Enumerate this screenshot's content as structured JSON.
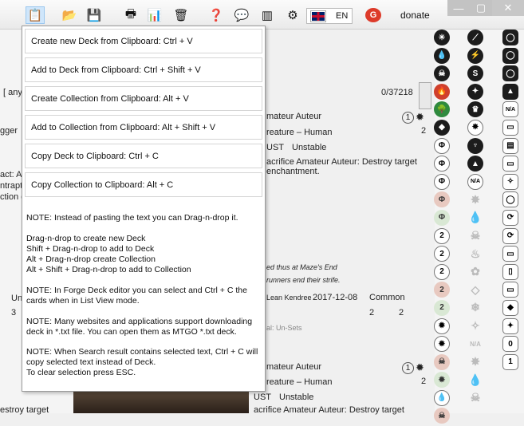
{
  "toolbar": {
    "icons": [
      "paste-icon",
      "open-folder-icon",
      "save-icon",
      "print-icon",
      "chart-icon",
      "trash-icon",
      "help-icon",
      "comment-icon",
      "layout-icon",
      "gear-icon"
    ],
    "language": "EN",
    "donate": "donate"
  },
  "menu": {
    "items": [
      "Create new Deck from Clipboard: Ctrl + V",
      "Add to Deck from Clipboard: Ctrl + Shift + V",
      "Create Collection from Clipboard: Alt + V",
      "Add to Collection from Clipboard: Alt + Shift + V",
      "Copy Deck to Clipboard: Ctrl + C",
      "Copy Collection to Clipboard: Alt + C"
    ],
    "notes": [
      "NOTE: Instead of pasting the text you can Drag-n-drop it.",
      "Drag-n-drop to create new Deck\nShift + Drag-n-drop to add to Deck\nAlt + Drag-n-drop create Collection\nAlt + Shift + Drag-n-drop to add to Collection",
      "NOTE: In Forge Deck editor you can select and Ctrl + C the cards when in List View mode.",
      "NOTE: Many websites and applications support downloading deck in *.txt file. You can open them as MTGO *.txt deck.",
      "NOTE: When Search result contains selected text, Ctrl + C will copy selected text instead of Deck.\nTo clear selection press ESC."
    ]
  },
  "background": {
    "search_stub": "[ any",
    "counter": "0/37218",
    "left_fragments": [
      "gger",
      "act: A",
      "ntrapt",
      "ction de",
      "Un",
      "3",
      "estroy target"
    ],
    "card1": {
      "name": "mateur Auteur",
      "type": "reature – Human",
      "set_code": "UST",
      "set_name": "Unstable",
      "text": "acrifice Amateur Auteur: Destroy target\nenchantment.",
      "count": "2",
      "mana": "1"
    },
    "flavor": "ed thus at Maze's End\nrunners end their strife.",
    "artist": "Lean Kendree",
    "date": "2017-12-08",
    "rarity": "Common",
    "num_a": "2",
    "num_b": "2",
    "legal": "al: Un-Sets",
    "card2": {
      "name": "mateur Auteur",
      "type": "reature – Human",
      "set_code": "UST",
      "set_name": "Unstable",
      "text": "acrifice Amateur Auteur: Destroy target",
      "count": "2"
    }
  },
  "symbols": {
    "col_mana": [
      "☀",
      "💧",
      "☠",
      "🔥",
      "🌳",
      "◆",
      "Φ",
      "Φ",
      "Φ",
      "Φ",
      "Φ",
      "2",
      "2",
      "2",
      "2",
      "2",
      "☀",
      "☀",
      "☠",
      "☀",
      "💧",
      "☠"
    ],
    "col_mana2": [
      "⟋",
      "⚡",
      "S",
      "✦",
      "♛",
      "✸",
      "♆",
      "▲",
      "N/A",
      "✸",
      "💧",
      "☠",
      "♨",
      "✿",
      "◇",
      "❄",
      "✧",
      "N/A",
      "✸",
      "💧",
      "☠"
    ],
    "col_sets": [
      "◯",
      "◯",
      "◯",
      "▲",
      "N/A",
      "▭",
      "▤",
      "▭",
      "✧",
      "◯",
      "⟳",
      "⟳",
      "▭",
      "▯",
      "▭",
      "◆",
      "✦",
      "0",
      "1"
    ]
  }
}
